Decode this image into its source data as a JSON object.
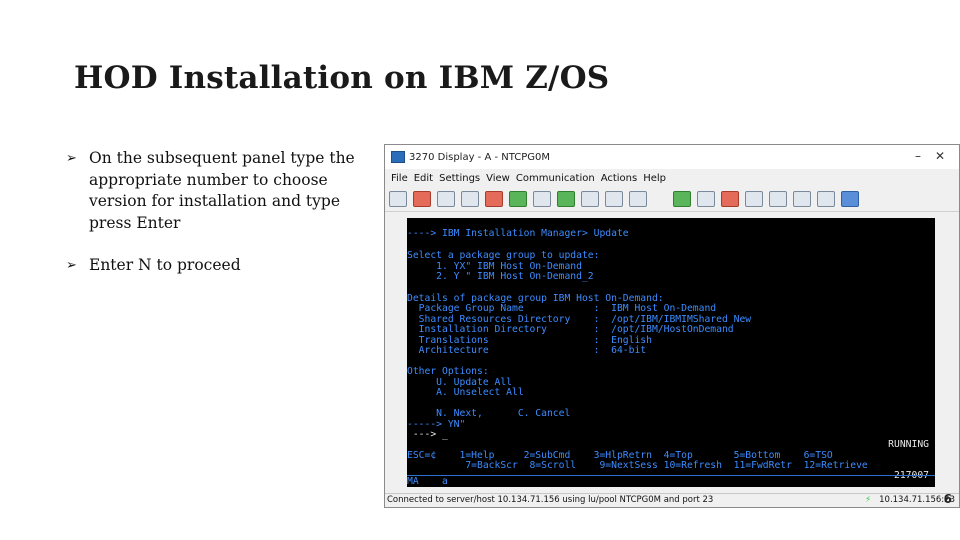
{
  "slide": {
    "title": "HOD Installation on IBM Z/OS",
    "bullets": [
      "On the subsequent panel type the appropriate number to choose version  for installation and type press Enter",
      "Enter N to proceed"
    ],
    "page_number": "6"
  },
  "window": {
    "title": "3270 Display - A - NTCPG0M",
    "minimize": "–",
    "close": "✕",
    "menus": [
      "File",
      "Edit",
      "Settings",
      "View",
      "Communication",
      "Actions",
      "Help"
    ]
  },
  "terminal": {
    "line1": "----> IBM Installation Manager> Update",
    "line2": "Select a package group to update:",
    "line3": "     1. YX\" IBM Host On-Demand",
    "line4": "     2. Y \" IBM Host On-Demand_2",
    "line5": "Details of package group IBM Host On-Demand:",
    "line6": "  Package Group Name            :  IBM Host On-Demand",
    "line7": "  Shared Resources Directory    :  /opt/IBM/IBMIMShared New",
    "line8": "  Installation Directory        :  /opt/IBM/HostOnDemand",
    "line9": "  Translations                  :  English",
    "line10": "  Architecture                  :  64-bit",
    "line11": "Other Options:",
    "line12": "     U. Update All",
    "line13": "     A. Unselect All",
    "line14": "     N. Next,      C. Cancel",
    "line15": "-----> YN\"",
    "line16": " ---> _",
    "line17": "RUNNING",
    "line18": "ESC=¢    1=Help     2=SubCmd    3=HlpRetrn  4=Top       5=Bottom    6=TSO",
    "line19": "          7=BackScr  8=Scroll    9=NextSess 10=Refresh  11=FwdRetr  12=Retrieve",
    "line20": "217007",
    "oia": "MA    a"
  },
  "status": {
    "text": "Connected to server/host 10.134.71.156 using lu/pool NTCPG0M and port 23",
    "ip": "10.134.71.156:23"
  }
}
